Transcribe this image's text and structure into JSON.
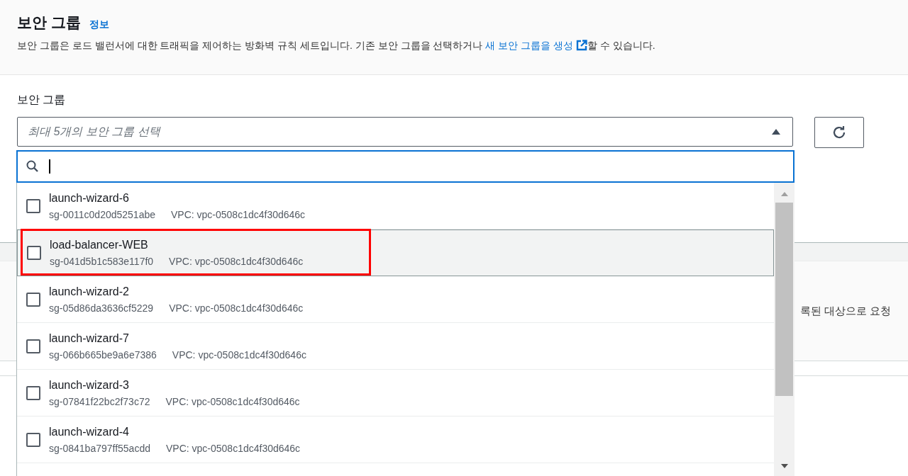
{
  "header": {
    "title": "보안 그룹",
    "info_link": "정보",
    "description_before": "보안 그룹은 로드 밸런서에 대한 트래픽을 제어하는 방화벽 규칙 세트입니다. 기존 보안 그룹을 선택하거나 ",
    "description_link": "새 보안 그룹을 생성",
    "description_after": "할 수 있습니다."
  },
  "field": {
    "label": "보안 그룹",
    "placeholder": "최대 5개의 보안 그룹 선택",
    "expanded": true
  },
  "search": {
    "focused": true
  },
  "options": [
    {
      "name": "launch-wizard-6",
      "id": "sg-0011c0d20d5251abe",
      "vpc": "VPC: vpc-0508c1dc4f30d646c",
      "checked": false,
      "highlighted": false,
      "annotated": false
    },
    {
      "name": "load-balancer-WEB",
      "id": "sg-041d5b1c583e117f0",
      "vpc": "VPC: vpc-0508c1dc4f30d646c",
      "checked": false,
      "highlighted": true,
      "annotated": true
    },
    {
      "name": "launch-wizard-2",
      "id": "sg-05d86da3636cf5229",
      "vpc": "VPC: vpc-0508c1dc4f30d646c",
      "checked": false,
      "highlighted": false,
      "annotated": false
    },
    {
      "name": "launch-wizard-7",
      "id": "sg-066b665be9a6e7386",
      "vpc": "VPC: vpc-0508c1dc4f30d646c",
      "checked": false,
      "highlighted": false,
      "annotated": false
    },
    {
      "name": "launch-wizard-3",
      "id": "sg-07841f22bc2f73c72",
      "vpc": "VPC: vpc-0508c1dc4f30d646c",
      "checked": false,
      "highlighted": false,
      "annotated": false
    },
    {
      "name": "launch-wizard-4",
      "id": "sg-0841ba797ff55acdd",
      "vpc": "VPC: vpc-0508c1dc4f30d646c",
      "checked": false,
      "highlighted": false,
      "annotated": false
    }
  ],
  "background_text": "록된 대상으로 요청"
}
